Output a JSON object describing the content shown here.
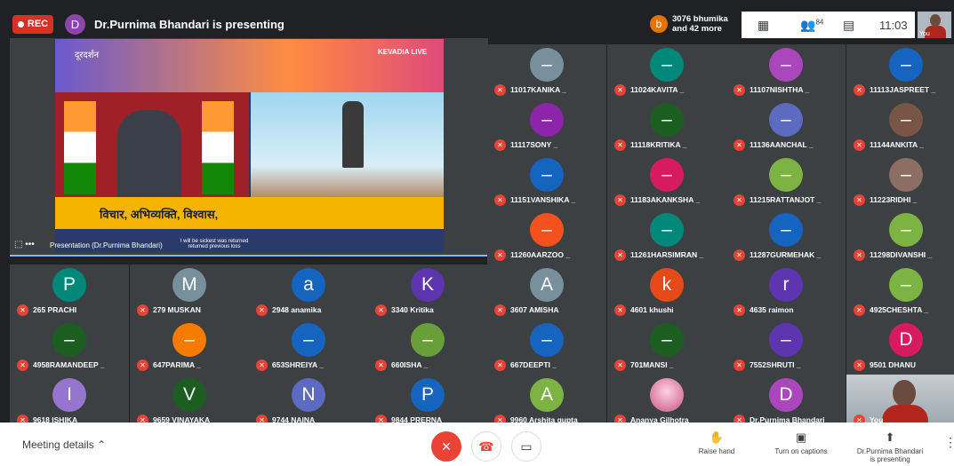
{
  "header": {
    "rec_label": "REC",
    "presenter_initial": "D",
    "presenting_text": "Dr.Purnima Bhandari is presenting",
    "participants_chip": {
      "initial": "b",
      "line1": "3076 bhumika",
      "line2": "and 42 more"
    },
    "participant_count": "84",
    "time": "11:03",
    "self_label": "You"
  },
  "presentation": {
    "logo_text": "दूरदर्शन",
    "live_text": "KEVADIA LIVE",
    "banner_text": "विचार, अभिव्यक्ति, विश्वास,",
    "subtitle_text": "I will be sickest was returned returned previous loss",
    "footer_label": "Presentation (Dr.Purnima Bhandari)"
  },
  "tiles": [
    {
      "initial": "–",
      "name": "11017KANIKA _",
      "color": "#78909c"
    },
    {
      "initial": "–",
      "name": "11024KAVITA _",
      "color": "#00897b"
    },
    {
      "initial": "–",
      "name": "11107NISHTHA _",
      "color": "#ab47bc"
    },
    {
      "initial": "–",
      "name": "11113JASPREET _",
      "color": "#1565c0"
    },
    {
      "initial": "–",
      "name": "11117SONY _",
      "color": "#8e24aa"
    },
    {
      "initial": "–",
      "name": "11118KRITIKA _",
      "color": "#1b5e20"
    },
    {
      "initial": "–",
      "name": "11136AANCHAL _",
      "color": "#5c6bc0"
    },
    {
      "initial": "–",
      "name": "11144ANKITA _",
      "color": "#795548"
    },
    {
      "initial": "–",
      "name": "11151VANSHIKA _",
      "color": "#1565c0"
    },
    {
      "initial": "–",
      "name": "11183AKANKSHA _",
      "color": "#d81b60"
    },
    {
      "initial": "–",
      "name": "11215RATTANJOT _",
      "color": "#7cb342"
    },
    {
      "initial": "–",
      "name": "11223RIDHI _",
      "color": "#8d6e63"
    },
    {
      "initial": "–",
      "name": "11260AARZOO _",
      "color": "#f4511e"
    },
    {
      "initial": "–",
      "name": "11261HARSIMRAN _",
      "color": "#00897b"
    },
    {
      "initial": "–",
      "name": "11287GURMEHAK _",
      "color": "#1565c0"
    },
    {
      "initial": "–",
      "name": "11298DIVANSHI _",
      "color": "#7cb342"
    },
    {
      "initial": "P",
      "name": "265 PRACHI",
      "color": "#00897b"
    },
    {
      "initial": "M",
      "name": "279 MUSKAN",
      "color": "#78909c"
    },
    {
      "initial": "a",
      "name": "2948 anamika",
      "color": "#1565c0"
    },
    {
      "initial": "K",
      "name": "3340 Kritika",
      "color": "#5e35b1"
    },
    {
      "initial": "A",
      "name": "3607 AMISHA",
      "color": "#78909c"
    },
    {
      "initial": "k",
      "name": "4601 khushi",
      "color": "#e64a19"
    },
    {
      "initial": "r",
      "name": "4635 raimon",
      "color": "#5e35b1"
    },
    {
      "initial": "–",
      "name": "4925CHESHTA _",
      "color": "#7cb342"
    },
    {
      "initial": "–",
      "name": "4958RAMANDEEP _",
      "color": "#1b5e20"
    },
    {
      "initial": "–",
      "name": "647PARIMA _",
      "color": "#f57c00"
    },
    {
      "initial": "–",
      "name": "653SHREIYA _",
      "color": "#1565c0"
    },
    {
      "initial": "–",
      "name": "660ISHA _",
      "color": "#689f38"
    },
    {
      "initial": "–",
      "name": "667DEEPTI _",
      "color": "#1565c0"
    },
    {
      "initial": "–",
      "name": "701MANSI _",
      "color": "#1b5e20"
    },
    {
      "initial": "–",
      "name": "7552SHRUTI _",
      "color": "#5e35b1"
    },
    {
      "initial": "D",
      "name": "9501 DHANU",
      "color": "#d81b60"
    },
    {
      "initial": "I",
      "name": "9618 ISHIKA",
      "color": "#9575cd"
    },
    {
      "initial": "V",
      "name": "9659 VINAYAKA",
      "color": "#1b5e20"
    },
    {
      "initial": "N",
      "name": "9744 NAINA",
      "color": "#5c6bc0"
    },
    {
      "initial": "P",
      "name": "9844 PRERNA",
      "color": "#1565c0"
    },
    {
      "initial": "A",
      "name": "9960 Arshita gupta",
      "color": "#7cb342"
    },
    {
      "initial": "",
      "name": "Ananya Gilhotra",
      "color": "#d77aa0",
      "photo": true
    },
    {
      "initial": "D",
      "name": "Dr.Purnima Bhandari",
      "color": "#ab47bc"
    },
    {
      "initial": "",
      "name": "You",
      "color": "#9aa3ab",
      "self": true
    }
  ],
  "footer": {
    "meeting_details": "Meeting details",
    "raise_hand": "Raise hand",
    "captions": "Turn on captions",
    "presenting_line1": "Dr.Purnima Bhandari",
    "presenting_line2": "is presenting"
  }
}
